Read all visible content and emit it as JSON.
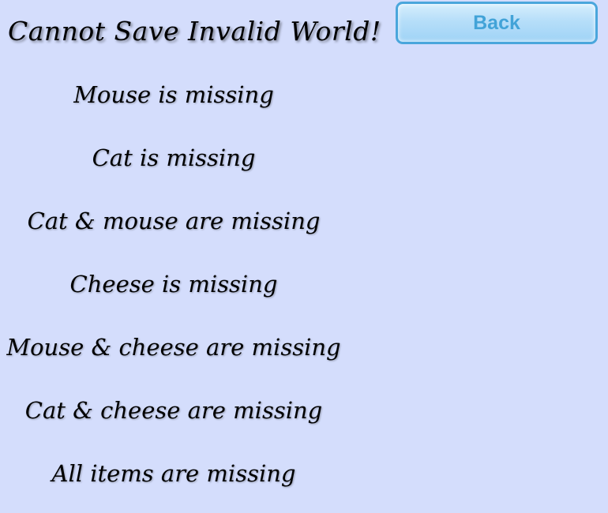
{
  "header": {
    "title": "Cannot Save Invalid World!",
    "back_label": "Back"
  },
  "messages": [
    "Mouse is missing",
    "Cat is missing",
    "Cat & mouse are missing",
    "Cheese is missing",
    "Mouse & cheese are missing",
    "Cat & cheese are missing",
    "All items are missing"
  ],
  "colors": {
    "background": "#d4ddfc",
    "button_border": "#4aa6dc",
    "button_text": "#42a3d8"
  }
}
